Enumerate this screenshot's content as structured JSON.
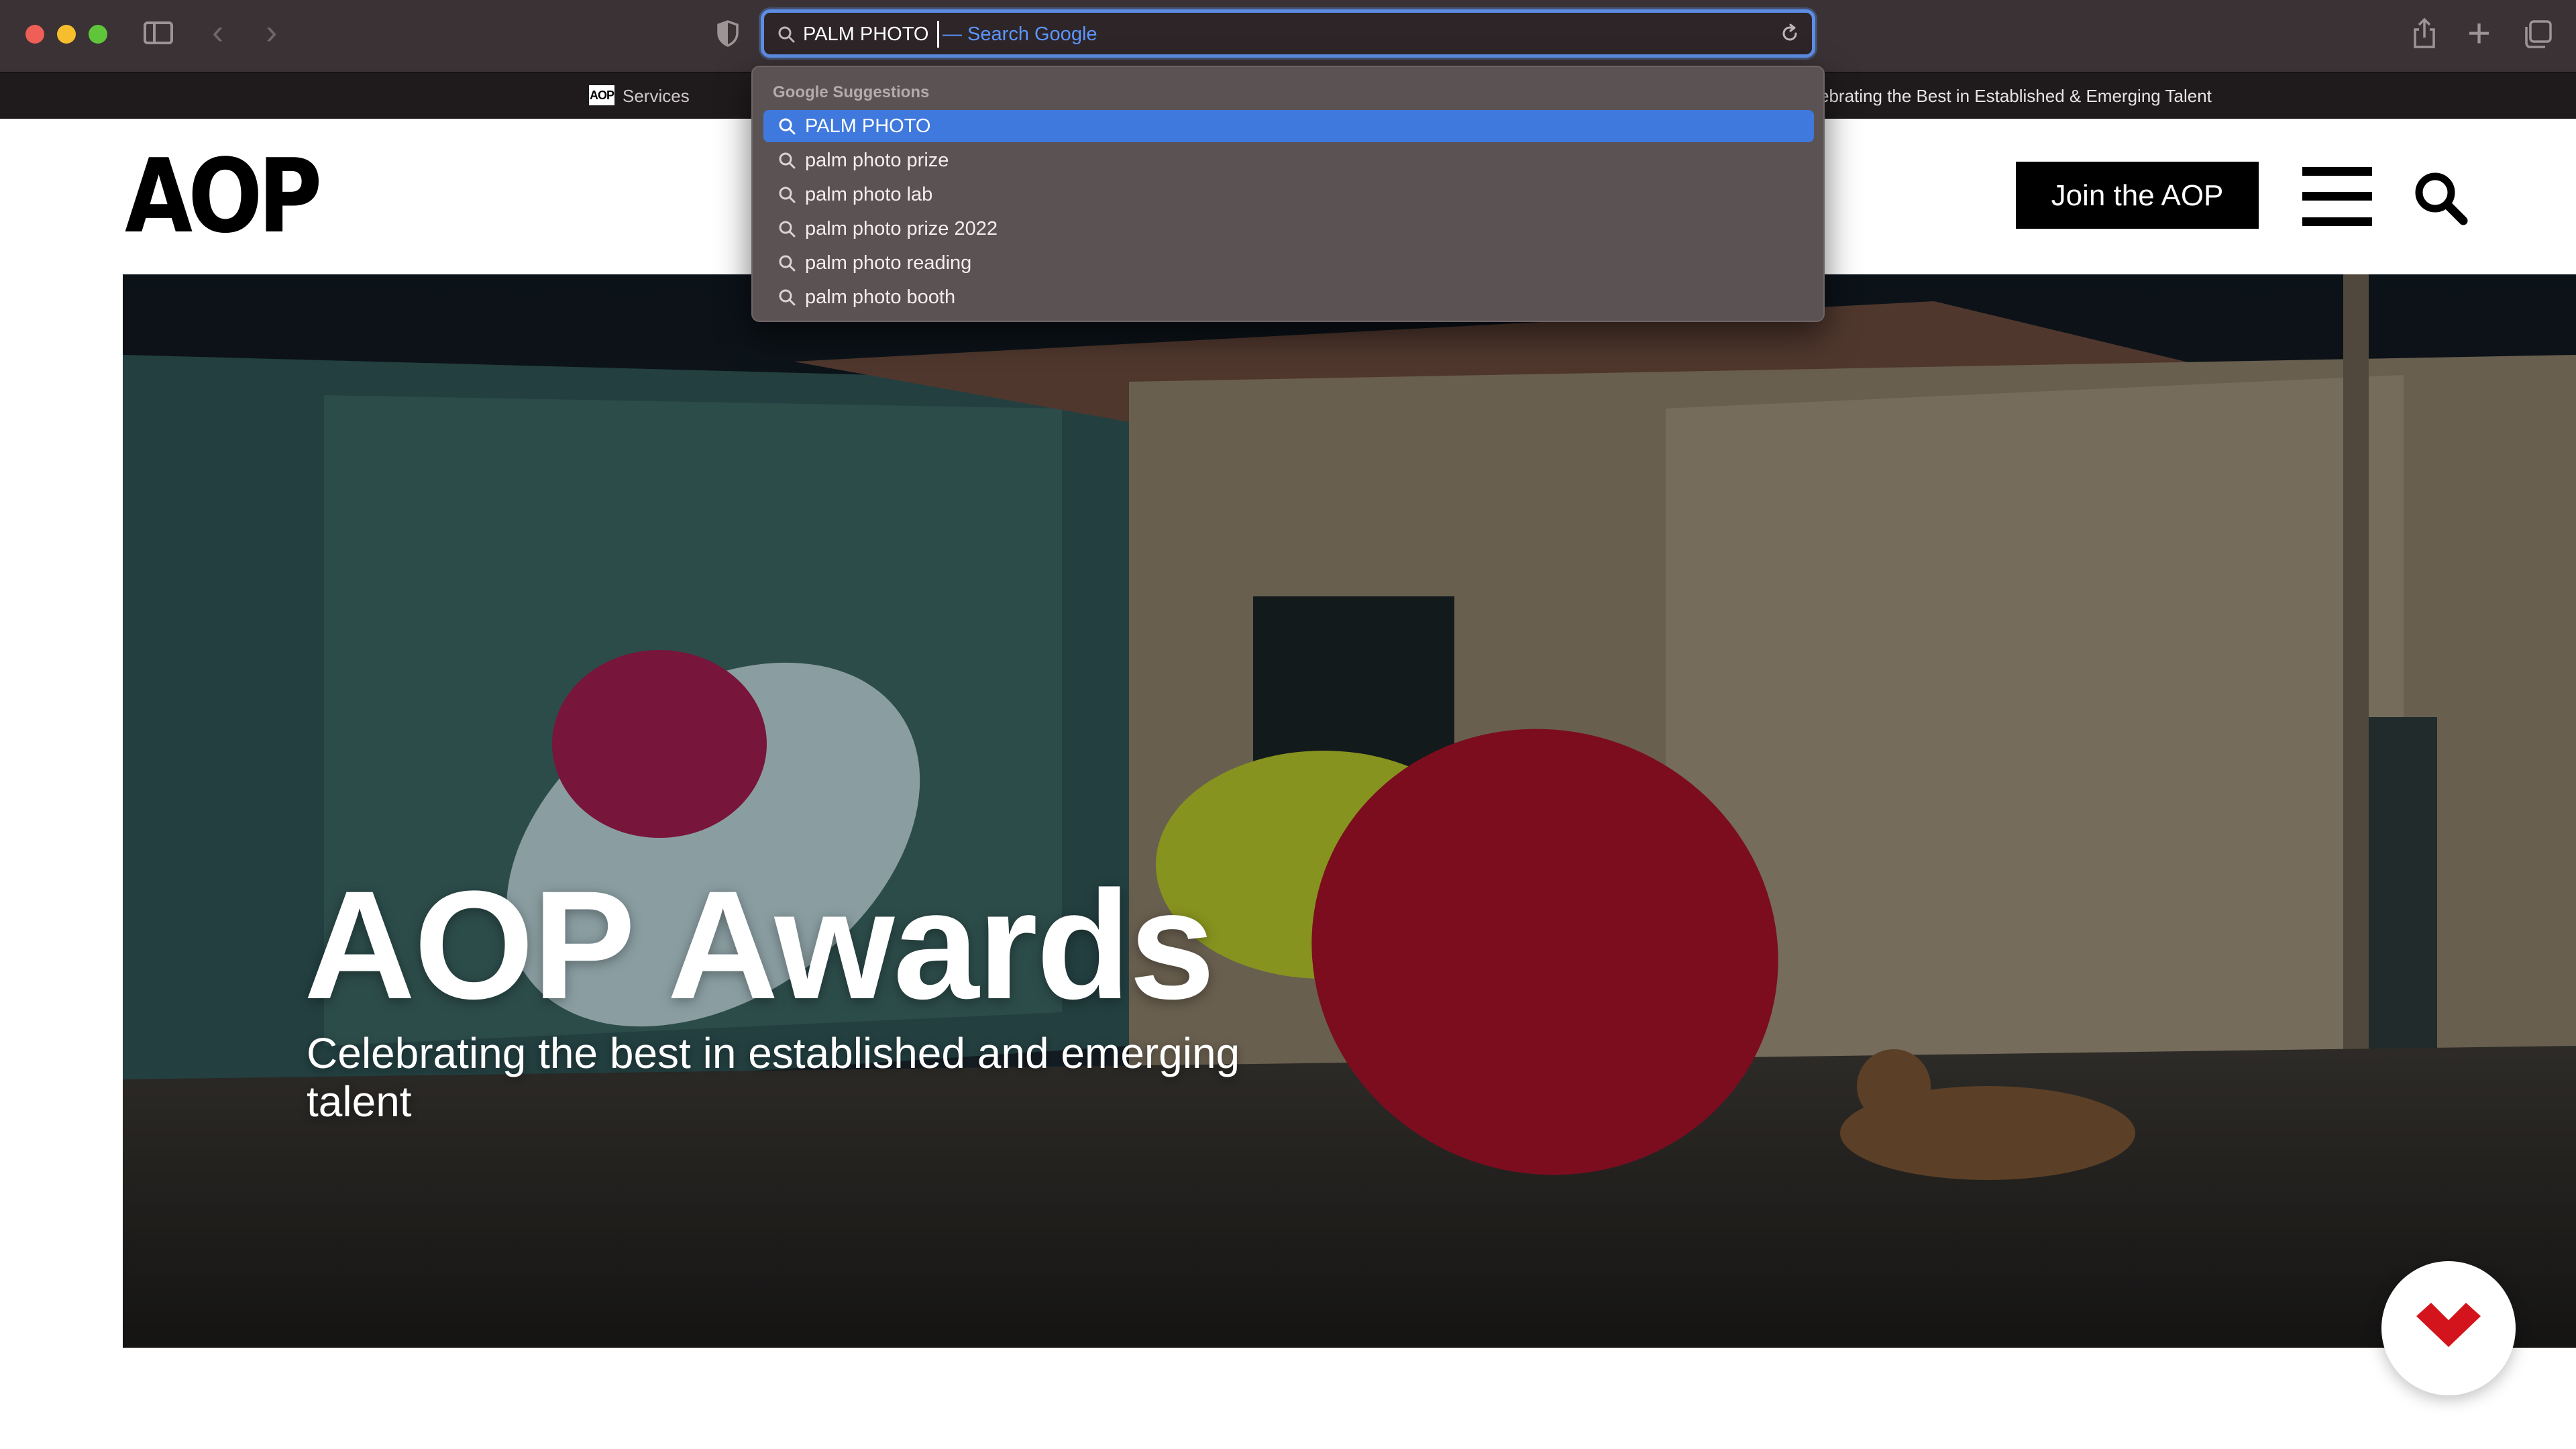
{
  "browser": {
    "address_bar": {
      "query": "PALM PHOTO",
      "hint": "— Search Google"
    },
    "favorites": {
      "services_label": "Services",
      "logo_text": "AOP",
      "right_text": "ebrating the Best in Established & Emerging Talent"
    },
    "suggestions": {
      "heading": "Google Suggestions",
      "items": [
        {
          "label": "PALM PHOTO",
          "selected": true
        },
        {
          "label": "palm photo prize",
          "selected": false
        },
        {
          "label": "palm photo lab",
          "selected": false
        },
        {
          "label": "palm photo prize 2022",
          "selected": false
        },
        {
          "label": "palm photo reading",
          "selected": false
        },
        {
          "label": "palm photo booth",
          "selected": false
        }
      ]
    }
  },
  "site": {
    "logo": "AOP",
    "join_label": "Join the AOP",
    "hero": {
      "title": "AOP Awards",
      "subtitle": "Celebrating the best in established and emerging talent"
    }
  },
  "colors": {
    "accent_blue": "#3f79dd",
    "badge_red": "#d3141c",
    "toolbar_bg": "#3a3234"
  }
}
